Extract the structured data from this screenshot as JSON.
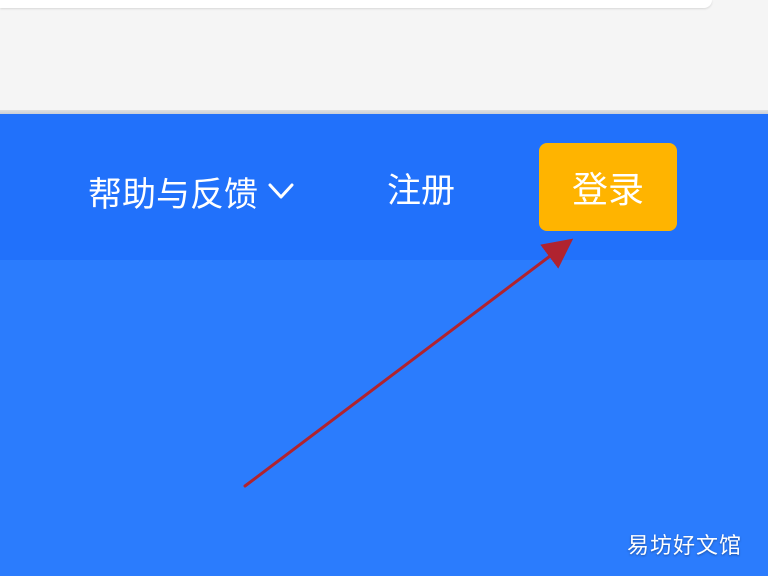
{
  "nav": {
    "help_label": "帮助与反馈",
    "help_icon": "chevron-down-icon",
    "register_label": "注册",
    "login_label": "登录"
  },
  "watermark": "易坊好文馆",
  "colors": {
    "nav_background": "#2171fb",
    "content_background": "#2b7cfd",
    "login_button": "#ffb400",
    "arrow": "#b0232f"
  }
}
